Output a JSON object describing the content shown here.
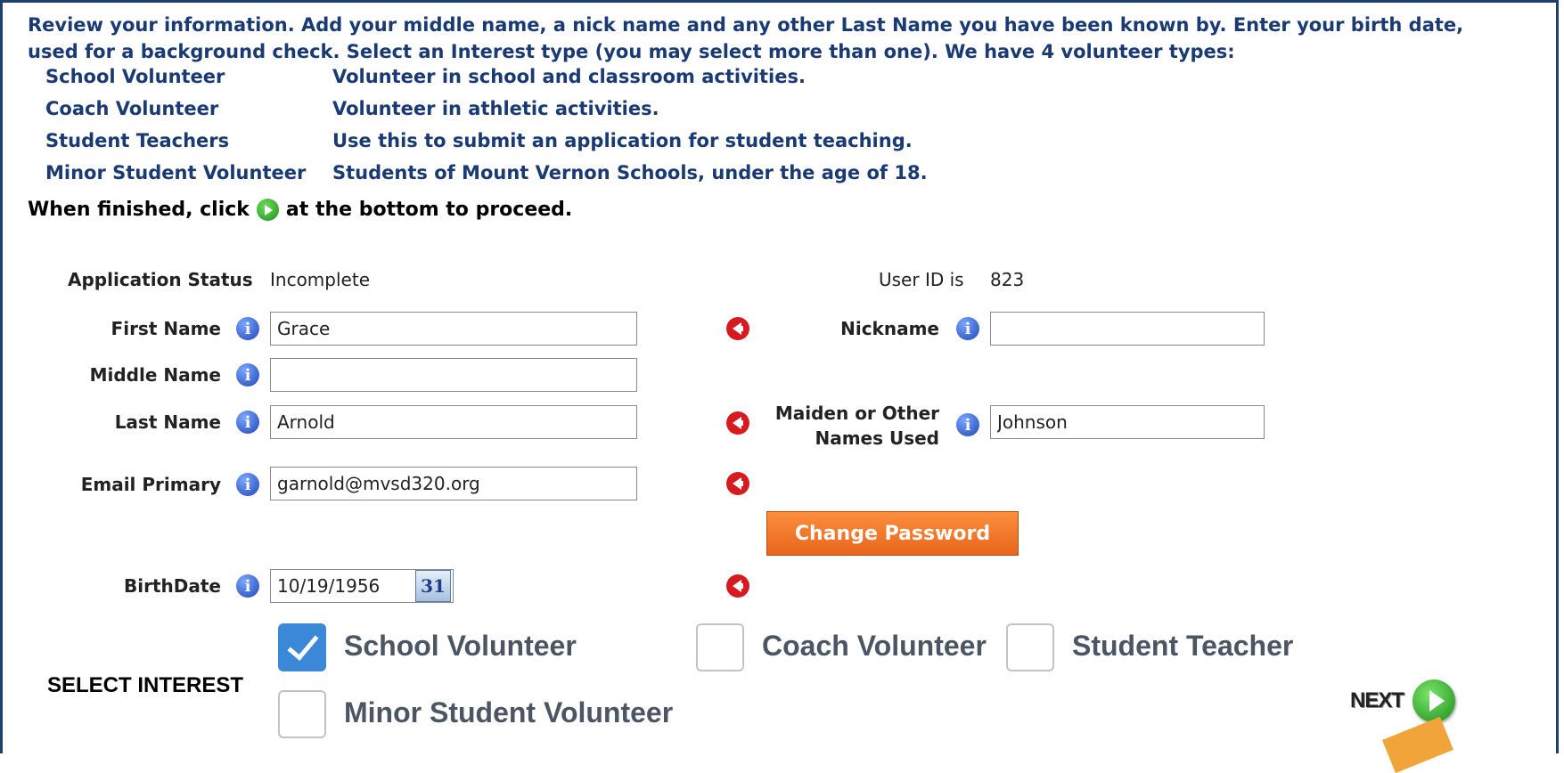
{
  "instructions": {
    "line1": "Review your information. Add your middle name, a nick name and any  other Last Name you have been known by. Enter your birth date,",
    "line2": "used for a background check.  Select an Interest type (you may select more than one). We have 4 volunteer types:",
    "types": [
      {
        "name": "School Volunteer",
        "desc": "Volunteer in school and classroom activities."
      },
      {
        "name": "Coach Volunteer",
        "desc": "Volunteer in athletic activities."
      },
      {
        "name": "Student Teachers",
        "desc": "Use this to submit an application for student teaching."
      },
      {
        "name": "Minor Student Volunteer",
        "desc": "Students of Mount Vernon Schools, under the age of 18."
      }
    ],
    "finish_before": "When finished, click",
    "finish_after": "at the bottom to proceed."
  },
  "status": {
    "label": "Application Status",
    "value": "Incomplete",
    "user_id_label": "User ID is",
    "user_id": "823"
  },
  "form": {
    "first_name": {
      "label": "First Name",
      "value": "Grace"
    },
    "middle_name": {
      "label": "Middle Name",
      "value": ""
    },
    "last_name": {
      "label": "Last Name",
      "value": "Arnold"
    },
    "email": {
      "label": "Email Primary",
      "value": "garnold@mvsd320.org"
    },
    "nickname": {
      "label": "Nickname",
      "value": ""
    },
    "maiden": {
      "label_line1": "Maiden or Other",
      "label_line2": "Names Used",
      "value": "Johnson"
    },
    "birthdate": {
      "label": "BirthDate",
      "value": "10/19/1956",
      "calendar_text": "31"
    },
    "change_password": "Change Password"
  },
  "interest": {
    "label": "SELECT INTEREST",
    "options": [
      {
        "label": "School Volunteer",
        "checked": true
      },
      {
        "label": "Coach Volunteer",
        "checked": false
      },
      {
        "label": "Student Teacher",
        "checked": false
      },
      {
        "label": "Minor Student Volunteer",
        "checked": false
      }
    ]
  },
  "next_label": "NEXT",
  "colors": {
    "heading": "#1a3a73",
    "button": "#f47a2a",
    "required": "#d71920",
    "checked": "#3b87d8"
  }
}
